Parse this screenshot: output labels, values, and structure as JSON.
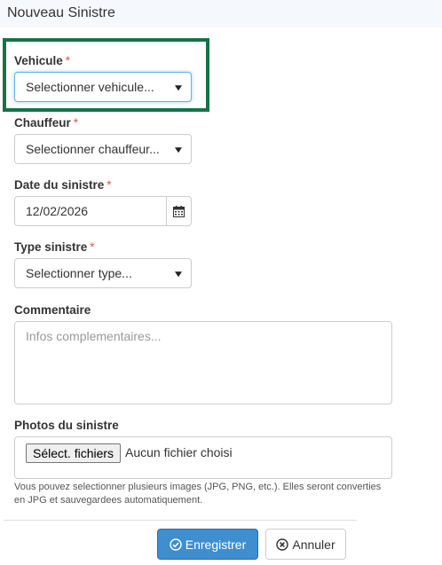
{
  "modal": {
    "title": "Nouveau Sinistre"
  },
  "form": {
    "vehicule": {
      "label": "Vehicule",
      "required_mark": "*",
      "value": "Selectionner vehicule..."
    },
    "chauffeur": {
      "label": "Chauffeur",
      "required_mark": "*",
      "value": "Selectionner chauffeur..."
    },
    "date": {
      "label": "Date du sinistre",
      "required_mark": "*",
      "value": "12/02/2026"
    },
    "type": {
      "label": "Type sinistre",
      "required_mark": "*",
      "value": "Selectionner type..."
    },
    "commentaire": {
      "label": "Commentaire",
      "placeholder": "Infos complementaires..."
    },
    "photos": {
      "label": "Photos du sinistre",
      "button_label": "Sélect. fichiers",
      "status": "Aucun fichier choisi",
      "help": "Vous pouvez selectionner plusieurs images (JPG, PNG, etc.). Elles seront converties en JPG et sauvegardees automatiquement."
    }
  },
  "footer": {
    "save_label": "Enregistrer",
    "cancel_label": "Annuler"
  },
  "colors": {
    "highlight": "#157347",
    "primary": "#3e8ed0",
    "required": "#d9534f"
  },
  "icons": {
    "date_picker": "calendar-icon",
    "save": "check-circle-icon",
    "cancel": "times-circle-icon",
    "dropdown": "caret-down-icon"
  }
}
